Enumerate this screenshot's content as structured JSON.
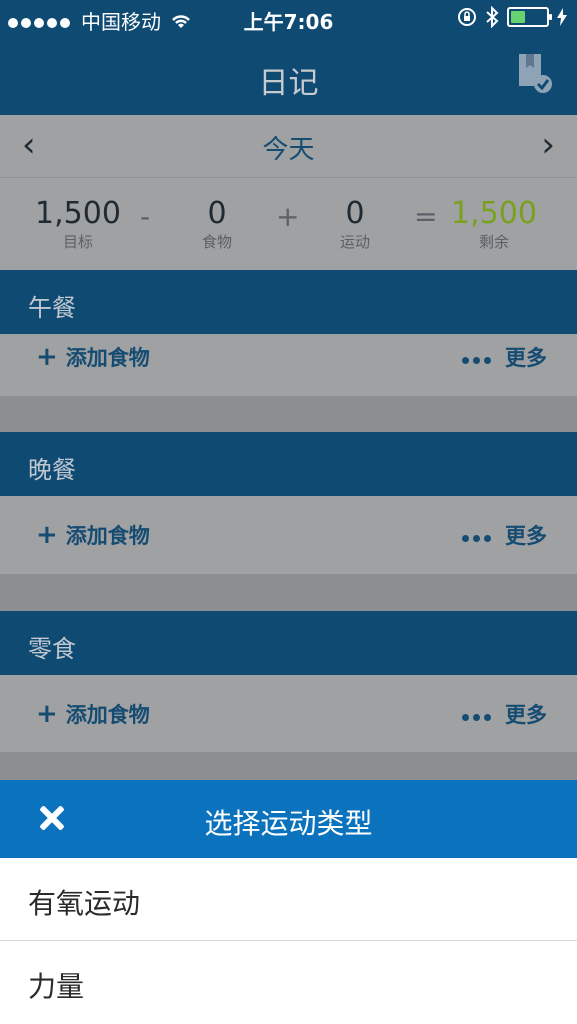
{
  "status_bar": {
    "carrier": "中国移动",
    "time": "上午7:06"
  },
  "nav": {
    "title": "日记",
    "bookmark_icon": "bookmark-check-icon"
  },
  "date_nav": {
    "today": "今天",
    "prev_icon": "chevron-left-icon",
    "next_icon": "chevron-right-icon"
  },
  "summary": {
    "goal": {
      "value": "1,500",
      "label": "目标"
    },
    "minus": "-",
    "food": {
      "value": "0",
      "label": "食物"
    },
    "plus": "+",
    "exercise": {
      "value": "0",
      "label": "运动"
    },
    "equals": "=",
    "remaining": {
      "value": "1,500",
      "label": "剩余",
      "color": "#7aa11e"
    }
  },
  "sections": [
    {
      "title": "午餐",
      "add_label": "添加食物",
      "more_label": "更多"
    },
    {
      "title": "晚餐",
      "add_label": "添加食物",
      "more_label": "更多"
    },
    {
      "title": "零食",
      "add_label": "添加食物",
      "more_label": "更多"
    }
  ],
  "sheet": {
    "title": "选择运动类型",
    "close_icon": "close-icon",
    "items": [
      {
        "label": "有氧运动"
      },
      {
        "label": "力量"
      }
    ]
  },
  "colors": {
    "navy": "#0f4a73",
    "sheet_blue": "#0b72bd",
    "remaining_green": "#7aa11e"
  }
}
